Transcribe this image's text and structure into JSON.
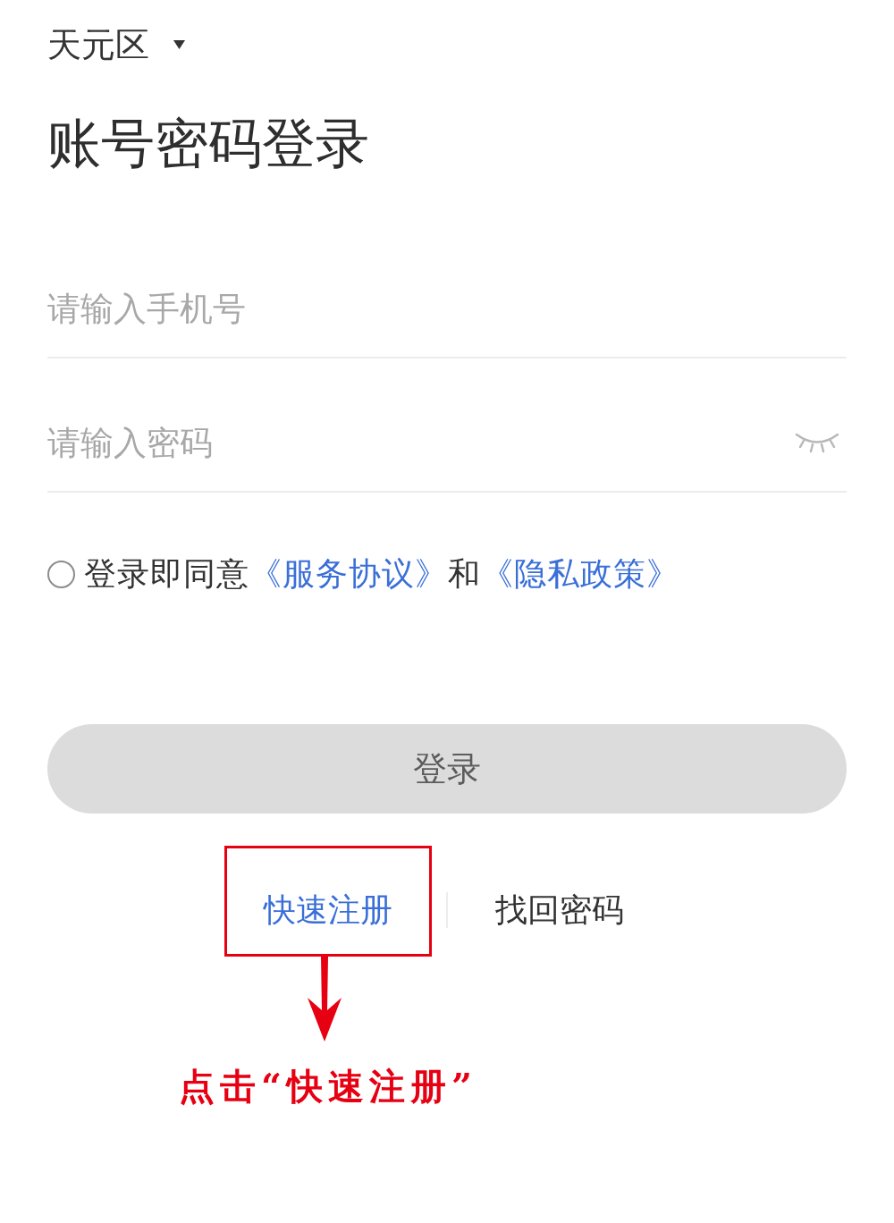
{
  "region_selector": {
    "label": "天元区"
  },
  "title": "账号密码登录",
  "fields": [
    {
      "kind": "phone",
      "placeholder": "请输入手机号"
    },
    {
      "kind": "password",
      "placeholder": "请输入密码",
      "show_password": false
    }
  ],
  "agreement": {
    "checked": false,
    "parts": [
      {
        "kind": "text",
        "text": "登录即同意"
      },
      {
        "kind": "link",
        "text": "《服务协议》"
      },
      {
        "kind": "text",
        "text": "和"
      },
      {
        "kind": "link",
        "text": "《隐私政策》"
      }
    ]
  },
  "login_button": {
    "label": "登录",
    "disabled": true
  },
  "secondary_links": [
    {
      "kind": "link",
      "label": "快速注册"
    },
    {
      "kind": "plain",
      "label": "找回密码"
    }
  ],
  "annotation": {
    "text": "点击“快速注册”"
  }
}
